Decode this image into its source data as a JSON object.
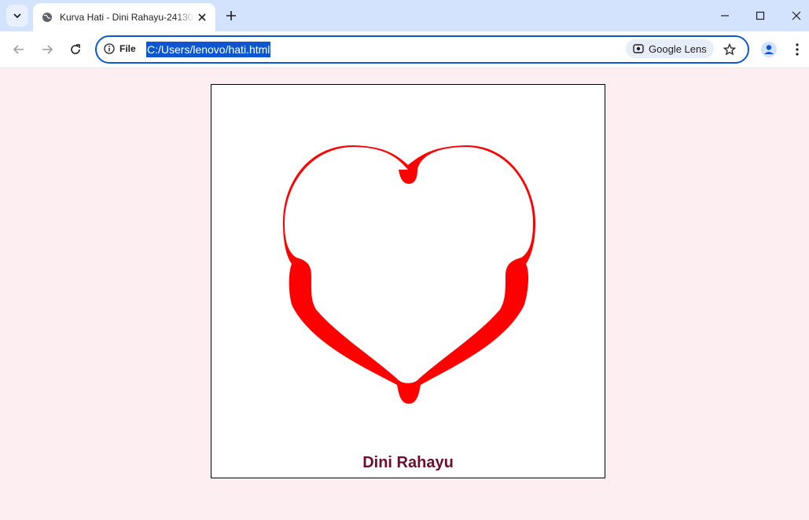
{
  "browser": {
    "tab_title": "Kurva Hati - Dini Rahayu-24130",
    "address_prefix": "File",
    "url": "C:/Users/lenovo/hati.html",
    "lens_label": "Google Lens"
  },
  "page": {
    "name_label": "Dini Rahayu",
    "colors": {
      "background": "#fdeef2",
      "heart": "#ff0000",
      "name_text": "#6b0f2c"
    }
  }
}
